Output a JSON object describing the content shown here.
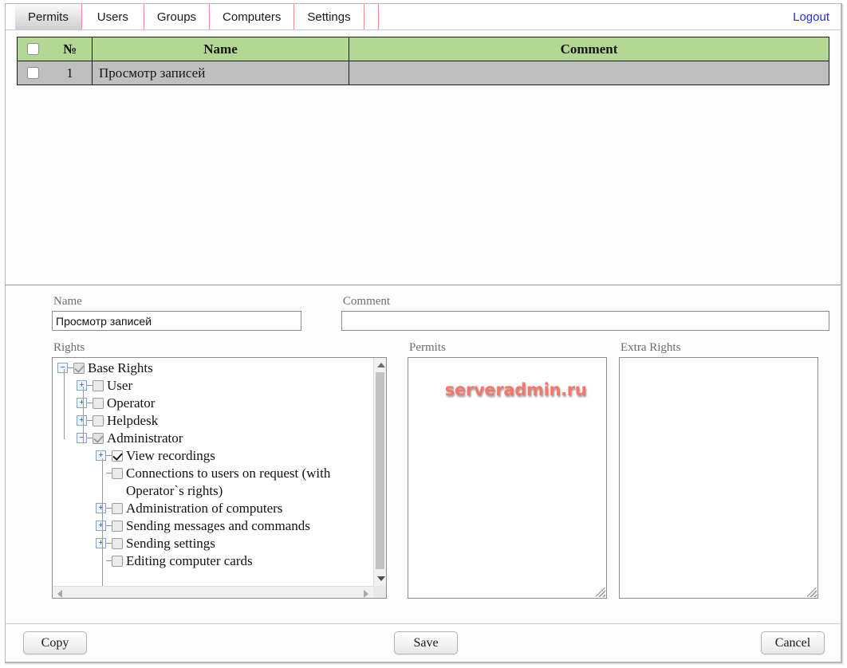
{
  "tabs": [
    {
      "label": "Permits",
      "active": true
    },
    {
      "label": "Users",
      "active": false
    },
    {
      "label": "Groups",
      "active": false
    },
    {
      "label": "Computers",
      "active": false
    },
    {
      "label": "Settings",
      "active": false
    }
  ],
  "logout_label": "Logout",
  "grid": {
    "columns": [
      "№",
      "Name",
      "Comment"
    ],
    "rows": [
      {
        "num": "1",
        "name": "Просмотр записей",
        "comment": ""
      }
    ]
  },
  "form": {
    "name_label": "Name",
    "name_value": "Просмотр записей",
    "name_placeholder": "",
    "comment_label": "Comment",
    "comment_value": "",
    "comment_placeholder": "",
    "rights_label": "Rights",
    "permits_label": "Permits",
    "extra_rights_label": "Extra Rights"
  },
  "tree": [
    {
      "label": "Base Rights",
      "expander": "−",
      "check": "dim",
      "indent": 0
    },
    {
      "label": "User",
      "expander": "+",
      "check": "off",
      "indent": 1
    },
    {
      "label": "Operator",
      "expander": "+",
      "check": "off",
      "indent": 1
    },
    {
      "label": "Helpdesk",
      "expander": "+",
      "check": "off",
      "indent": 1
    },
    {
      "label": "Administrator",
      "expander": "−",
      "check": "dim",
      "indent": 1
    },
    {
      "label": "View recordings",
      "expander": "+",
      "check": "on",
      "indent": 2
    },
    {
      "label": "Connections to users on request (with Operator`s rights)",
      "expander": "",
      "check": "off",
      "indent": 2
    },
    {
      "label": "Administration of computers",
      "expander": "+",
      "check": "off",
      "indent": 2
    },
    {
      "label": "Sending messages and commands",
      "expander": "+",
      "check": "off",
      "indent": 2
    },
    {
      "label": "Sending settings",
      "expander": "+",
      "check": "off",
      "indent": 2
    },
    {
      "label": "Editing computer cards",
      "expander": "",
      "check": "off",
      "indent": 2
    }
  ],
  "watermark": "serveradmin.ru",
  "footer": {
    "copy_label": "Copy",
    "save_label": "Save",
    "cancel_label": "Cancel"
  },
  "colors": {
    "header_green": "#b2d894",
    "selected_row_gray": "#bfbfbf",
    "link_blue": "#2a2aee",
    "tab_separator_red": "#f08b8b",
    "watermark_red": "#f5776b"
  }
}
